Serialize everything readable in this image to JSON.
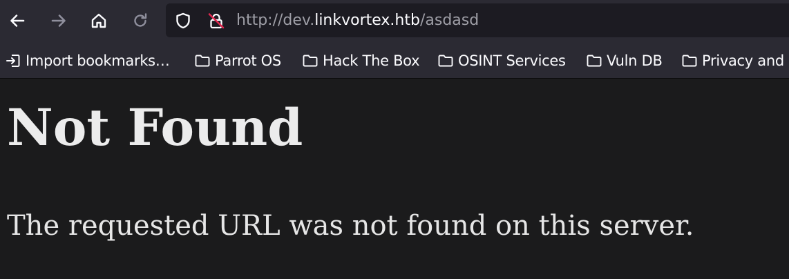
{
  "navbar": {
    "back_icon": "back-arrow-icon",
    "forward_icon": "forward-arrow-icon",
    "home_icon": "home-icon",
    "reload_icon": "reload-icon"
  },
  "urlbar": {
    "url_prefix": "http://dev.",
    "url_host": "linkvortex.htb",
    "url_path": "/asdasd",
    "shield_icon": "shield-icon",
    "insecure_lock_icon": "insecure-lock-icon"
  },
  "bookmarks": {
    "items": [
      {
        "label": "Import bookmarks…",
        "icon": "import-icon"
      },
      {
        "label": "Parrot OS",
        "icon": "folder-icon"
      },
      {
        "label": "Hack The Box",
        "icon": "folder-icon"
      },
      {
        "label": "OSINT Services",
        "icon": "folder-icon"
      },
      {
        "label": "Vuln DB",
        "icon": "folder-icon"
      },
      {
        "label": "Privacy and",
        "icon": "folder-icon"
      }
    ]
  },
  "page": {
    "heading": "Not Found",
    "message": "The requested URL was not found on this server."
  }
}
